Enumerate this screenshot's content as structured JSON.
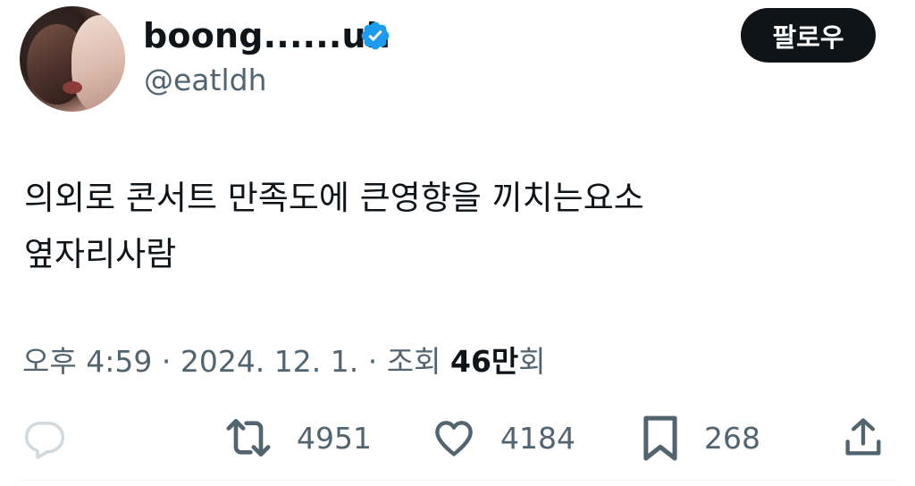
{
  "author": {
    "display_name": "boong......uh",
    "handle": "@eatldh",
    "verified_icon": "verified-badge-icon",
    "avatar_icon": "avatar-photo"
  },
  "follow_button": {
    "label": "팔로우"
  },
  "tweet": {
    "lines": [
      "의외로 콘서트 만족도에 큰영향을 끼치는요소",
      "옆자리사람"
    ]
  },
  "meta": {
    "time": "오후 4:59",
    "separator": "·",
    "date": "2024. 12. 1.",
    "views_label": "조회",
    "views_count": "46만",
    "views_suffix": "회"
  },
  "actions": {
    "reply": {
      "icon": "reply-icon",
      "count": ""
    },
    "retweet": {
      "icon": "retweet-icon",
      "count": "4951"
    },
    "like": {
      "icon": "heart-icon",
      "count": "4184"
    },
    "bookmark": {
      "icon": "bookmark-icon",
      "count": "268"
    },
    "share": {
      "icon": "share-icon"
    }
  },
  "colors": {
    "text_primary": "#0f1419",
    "text_secondary": "#536471",
    "verified_blue": "#1d9bf0",
    "reply_icon_gray": "#cfd9de",
    "button_bg": "#0f1419"
  }
}
